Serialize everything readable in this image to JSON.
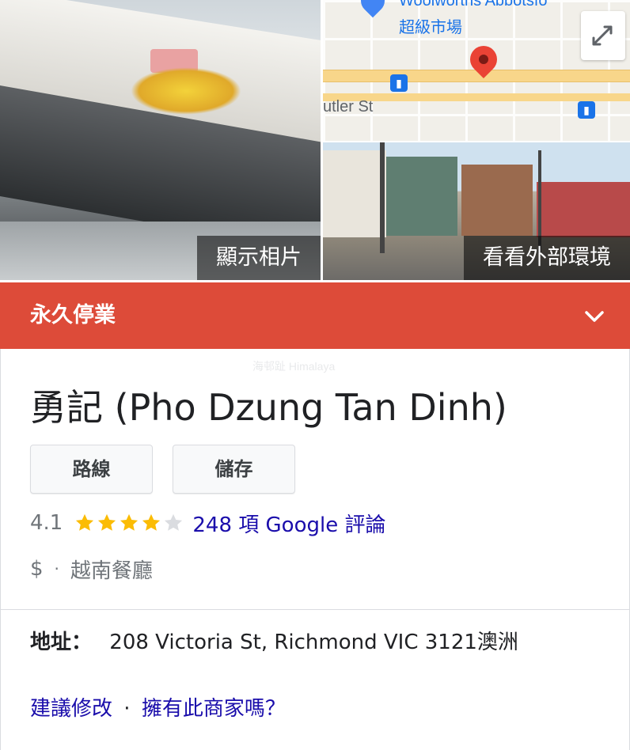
{
  "media": {
    "photos_label": "顯示相片",
    "street_view_label": "看看外部環境",
    "map": {
      "store_label": "超級市場",
      "store_name_partial": "Woolworths Abbotsfo",
      "street_label": "utler St"
    }
  },
  "status": {
    "closed_text": "永久停業"
  },
  "business": {
    "title": "勇記 (Pho Dzung Tan Dinh)",
    "buttons": {
      "route": "路線",
      "save": "儲存"
    },
    "rating": {
      "value": "4.1",
      "stars_filled": 4,
      "stars_total": 5,
      "reviews_text": "248 項 Google 評論"
    },
    "price": "$",
    "separator": "·",
    "category": "越南餐廳",
    "address": {
      "label": "地址：",
      "value": "208 Victoria St, Richmond VIC 3121澳洲"
    },
    "footer": {
      "suggest_edit": "建議修改",
      "separator": "·",
      "own_business": "擁有此商家嗎？"
    }
  },
  "colors": {
    "closed_bar": "#dd4b39",
    "link": "#1a0dab",
    "star": "#fbbc04",
    "star_empty": "#dadce0"
  },
  "icons": {
    "chevron": "chevron-down-icon",
    "expand": "expand-icon",
    "map_pin": "map-pin-icon",
    "bus": "bus-stop-icon",
    "star": "star-icon"
  }
}
